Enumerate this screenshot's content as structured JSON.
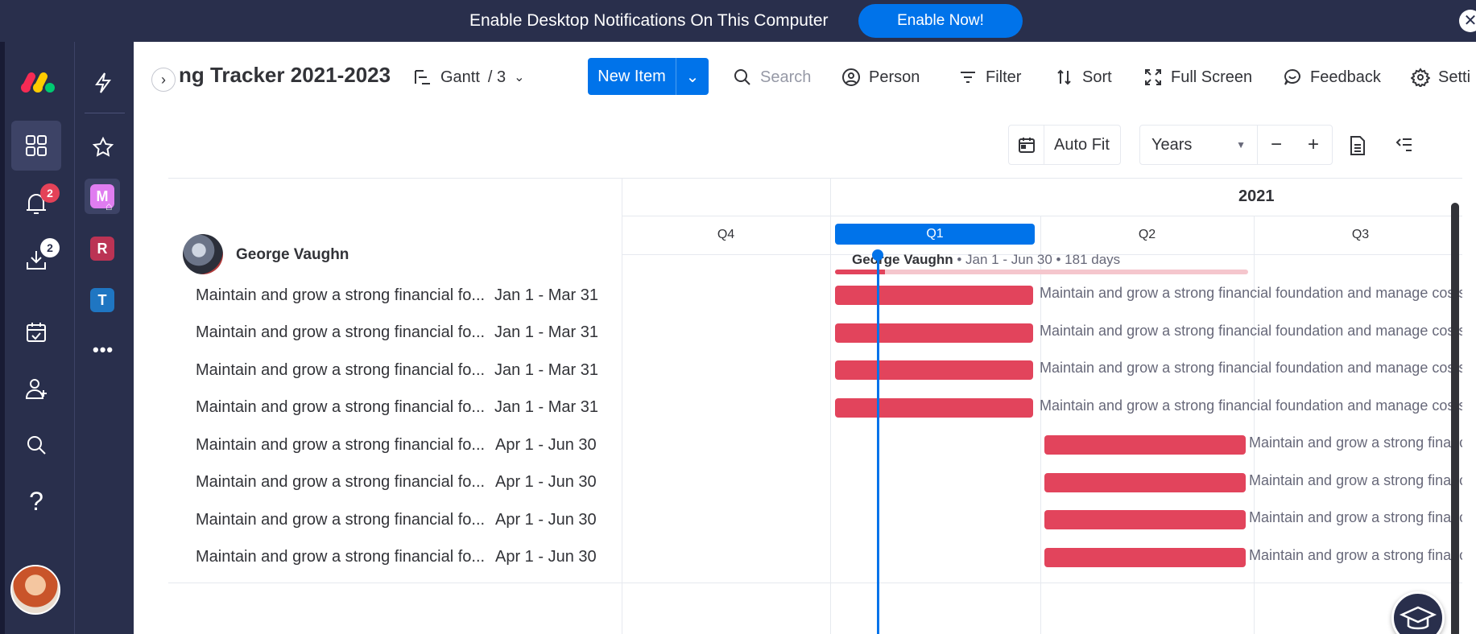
{
  "notification": {
    "text": "Enable Desktop Notifications On This Computer",
    "button": "Enable Now!",
    "close": "✕"
  },
  "left_rail": {
    "notifications_badge": "2",
    "inbox_badge": "2"
  },
  "workspaces": [
    {
      "letter": "M",
      "color": "#e07df0"
    },
    {
      "letter": "R",
      "color": "#bb3354"
    },
    {
      "letter": "T",
      "color": "#1f76c2"
    }
  ],
  "header": {
    "collapse": "›",
    "board_title": "ng Tracker 2021-2023",
    "view_label": "Gantt",
    "view_count": "/ 3",
    "new_item": "New Item",
    "search_placeholder": "Search",
    "person": "Person",
    "filter": "Filter",
    "sort": "Sort",
    "full_screen": "Full Screen",
    "feedback": "Feedback",
    "settings": "Setti"
  },
  "gantt_controls": {
    "auto_fit": "Auto Fit",
    "scale": "Years",
    "zoom_out": "−",
    "zoom_in": "+"
  },
  "timeline": {
    "year": "2021",
    "quarters": [
      "Q4",
      "Q1",
      "Q2",
      "Q3"
    ],
    "highlighted_quarter": "Q1"
  },
  "group": {
    "name": "George Vaughn",
    "summary_name": "George Vaughn",
    "summary_detail": " • Jan 1 - Jun 30 • 181 days",
    "progress": 0.12
  },
  "tasks": [
    {
      "name": "Maintain and grow a strong financial fo...",
      "dates": "Jan 1 - Mar 31",
      "bar_label": "Maintain and grow a strong financial foundation and manage costs",
      "quarter": "Q1"
    },
    {
      "name": "Maintain and grow a strong financial fo...",
      "dates": "Jan 1 - Mar 31",
      "bar_label": "Maintain and grow a strong financial foundation and manage costs",
      "quarter": "Q1"
    },
    {
      "name": "Maintain and grow a strong financial fo...",
      "dates": "Jan 1 - Mar 31",
      "bar_label": "Maintain and grow a strong financial foundation and manage costs",
      "quarter": "Q1"
    },
    {
      "name": "Maintain and grow a strong financial fo...",
      "dates": "Jan 1 - Mar 31",
      "bar_label": "Maintain and grow a strong financial foundation and manage costs",
      "quarter": "Q1"
    },
    {
      "name": "Maintain and grow a strong financial fo...",
      "dates": "Apr 1 - Jun 30",
      "bar_label": "Maintain and grow a strong financial foundation and manage costs",
      "quarter": "Q2"
    },
    {
      "name": "Maintain and grow a strong financial fo...",
      "dates": "Apr 1 - Jun 30",
      "bar_label": "Maintain and grow a strong financial foundation and manage costs",
      "quarter": "Q2"
    },
    {
      "name": "Maintain and grow a strong financial fo...",
      "dates": "Apr 1 - Jun 30",
      "bar_label": "Maintain and grow a strong financial foundation and manage costs",
      "quarter": "Q2"
    },
    {
      "name": "Maintain and grow a strong financial fo...",
      "dates": "Apr 1 - Jun 30",
      "bar_label": "Maintain and grow a strong financial foundation and manage costs",
      "quarter": "Q2"
    }
  ],
  "colors": {
    "primary": "#0073ea",
    "bar": "#e2445c",
    "nav": "#292f4c"
  }
}
